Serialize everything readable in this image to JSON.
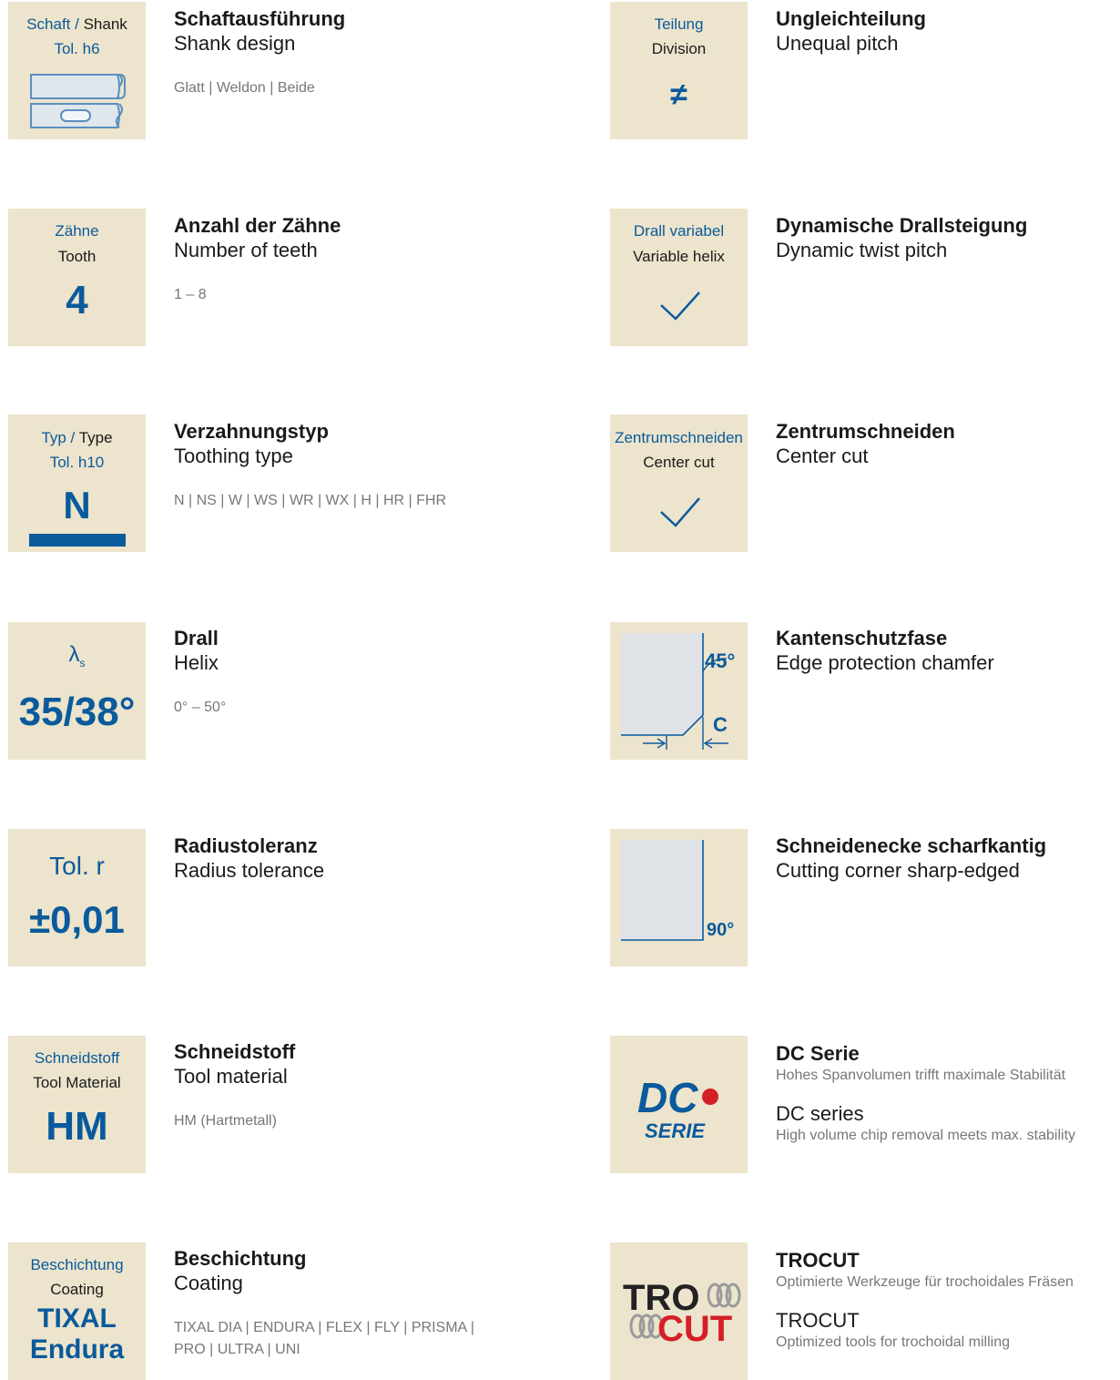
{
  "colors": {
    "tile_bg": "#ece4cc",
    "accent_blue": "#0a5a9c",
    "value_gray": "#777777",
    "trocut_red": "#d51f26"
  },
  "left": [
    {
      "tile": {
        "line1_blue": "Schaft / ",
        "line1_dark": "Shank",
        "line2": "Tol. h6",
        "icon": "shank-icons"
      },
      "title": "Schaftausführung",
      "subtitle": "Shank design",
      "values": "Glatt | Weldon | Beide"
    },
    {
      "tile": {
        "line1": "Zähne",
        "line2": "Tooth",
        "big": "4"
      },
      "title": "Anzahl der Zähne",
      "subtitle": "Number of teeth",
      "values": "1 – 8"
    },
    {
      "tile": {
        "line1_blue": "Typ / ",
        "line1_dark": "Type",
        "line2": "Tol. h10",
        "big": "N"
      },
      "title": "Verzahnungstyp",
      "subtitle": "Toothing type",
      "values": "N | NS | W | WS | WR | WX | H | HR | FHR"
    },
    {
      "tile": {
        "symbol": "λ",
        "subscript": "s",
        "big": "35/38°"
      },
      "title": "Drall",
      "subtitle": "Helix",
      "values": "0° – 50°"
    },
    {
      "tile": {
        "line1": "Tol. r",
        "big": "±0,01"
      },
      "title": "Radiustoleranz",
      "subtitle": "Radius tolerance",
      "values": ""
    },
    {
      "tile": {
        "line1": "Schneidstoff",
        "line2": "Tool Material",
        "big": "HM"
      },
      "title": "Schneidstoff",
      "subtitle": "Tool material",
      "values": "HM (Hartmetall)"
    },
    {
      "tile": {
        "line1": "Beschichtung",
        "line2": "Coating",
        "big1": "TIXAL",
        "big2": "Endura"
      },
      "title": "Beschichtung",
      "subtitle": "Coating",
      "values1": "TIXAL DIA | ENDURA | FLEX | FLY | PRISMA |",
      "values2": "PRO | ULTRA | UNI"
    }
  ],
  "right": [
    {
      "tile": {
        "line1": "Teilung",
        "line2": "Division",
        "symbol": "≠"
      },
      "title": "Ungleichteilung",
      "subtitle": "Unequal pitch"
    },
    {
      "tile": {
        "line1": "Drall variabel",
        "line2": "Variable helix",
        "icon": "check-icon"
      },
      "title": "Dynamische Drallsteigung",
      "subtitle": "Dynamic twist pitch"
    },
    {
      "tile": {
        "line1": "Zentrumschneiden",
        "line2": "Center cut",
        "icon": "check-icon"
      },
      "title": "Zentrumschneiden",
      "subtitle": "Center cut"
    },
    {
      "tile": {
        "angle": "45°",
        "dim": "C",
        "icon": "chamfer-diagram"
      },
      "title": "Kantenschutzfase",
      "subtitle": "Edge protection chamfer"
    },
    {
      "tile": {
        "angle": "90°",
        "icon": "sharp-corner-diagram"
      },
      "title": "Schneidenecke scharfkantig",
      "subtitle": "Cutting corner sharp-edged"
    },
    {
      "tile": {
        "logo": "dc-serie-logo"
      },
      "title": "DC Serie",
      "desc_de": "Hohes Spanvolumen trifft maximale Stabilität",
      "subtitle": "DC series",
      "desc_en": "High volume chip removal meets max. stability"
    },
    {
      "tile": {
        "logo": "trocut-logo"
      },
      "title": "TROCUT",
      "desc_de": "Optimierte Werkzeuge für trochoidales Fräsen",
      "subtitle": "TROCUT",
      "desc_en": "Optimized tools for trochoidal milling"
    }
  ]
}
